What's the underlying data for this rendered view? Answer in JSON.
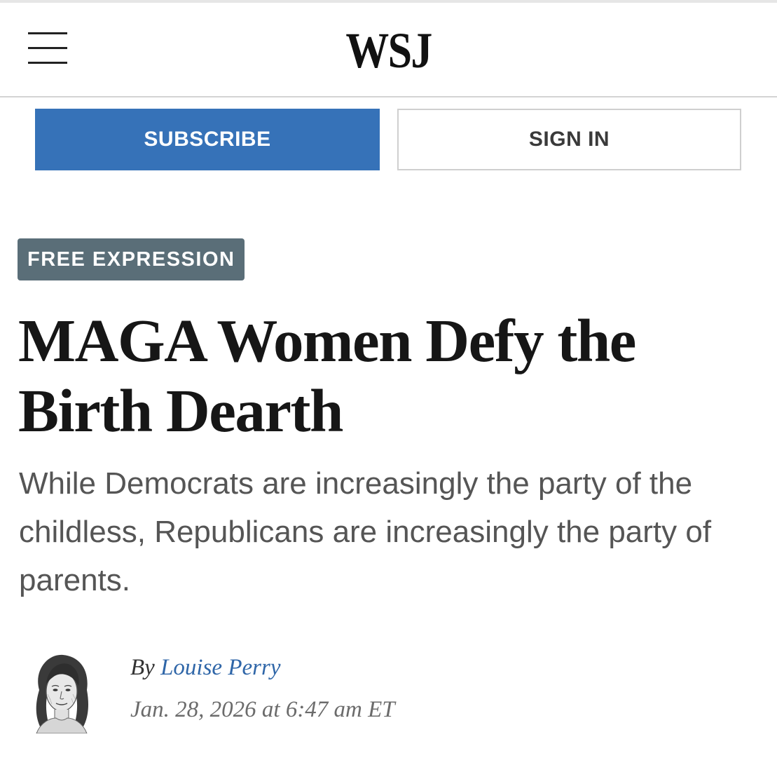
{
  "header": {
    "menu_icon": "hamburger-menu-icon",
    "logo_text": "WSJ"
  },
  "actions": {
    "subscribe_label": "SUBSCRIBE",
    "signin_label": "SIGN IN",
    "subscribe_color": "#3672b8"
  },
  "article": {
    "section_tag": "FREE EXPRESSION",
    "section_tag_color": "#5a6e78",
    "headline": "MAGA Women Defy the Birth Dearth",
    "dek": "While Democrats are increasingly the party of the childless, Republicans are increasingly the party of parents.",
    "byline_prefix": "By",
    "author": "Louise Perry",
    "author_color": "#2f66a8",
    "timestamp": "Jan. 28, 2026 at 6:47 am ET",
    "author_image": "author-portrait-sketch"
  }
}
